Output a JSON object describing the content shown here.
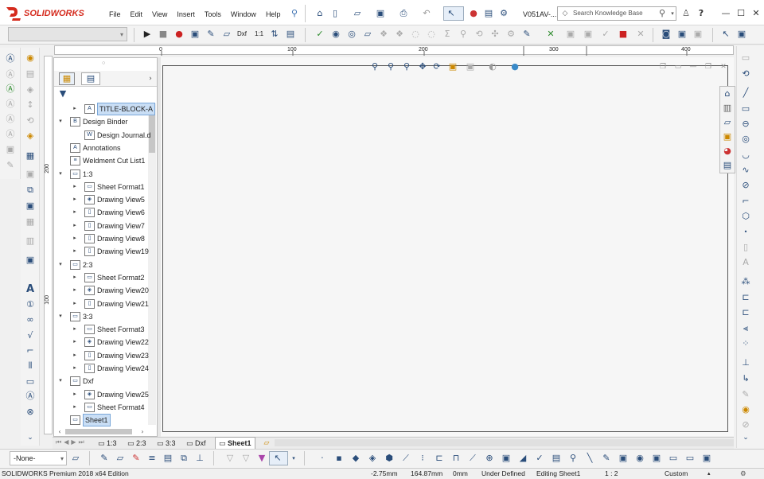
{
  "app": {
    "brand": "SOLIDWORKS",
    "title_short": "V051AV-...",
    "menu": [
      "File",
      "Edit",
      "View",
      "Insert",
      "Tools",
      "Window",
      "Help"
    ],
    "search_placeholder": "Search Knowledge Base"
  },
  "toolbar2": {
    "dxf_label": "Dxf",
    "scale_label": "1:1"
  },
  "ruler": {
    "ticks": [
      "0",
      "100",
      "200",
      "300",
      "400"
    ],
    "vticks": [
      "200",
      "100"
    ]
  },
  "tree": {
    "items": [
      {
        "label": "TITLE-BLOCK-A",
        "level": 1,
        "caret": "▸",
        "icon": "A",
        "selected": true
      },
      {
        "label": "Design Binder",
        "level": 0,
        "caret": "▾",
        "icon": "B"
      },
      {
        "label": "Design Journal.d",
        "level": 1,
        "caret": "",
        "icon": "W"
      },
      {
        "label": "Annotations",
        "level": 0,
        "caret": "",
        "icon": "A"
      },
      {
        "label": "Weldment Cut List1",
        "level": 0,
        "caret": "",
        "icon": "≡"
      },
      {
        "label": "1:3",
        "level": 0,
        "caret": "▾",
        "icon": "▭"
      },
      {
        "label": "Sheet Format1",
        "level": 1,
        "caret": "▸",
        "icon": "▭"
      },
      {
        "label": "Drawing View5",
        "level": 1,
        "caret": "▸",
        "icon": "◈"
      },
      {
        "label": "Drawing View6",
        "level": 1,
        "caret": "▸",
        "icon": "▯"
      },
      {
        "label": "Drawing View7",
        "level": 1,
        "caret": "▸",
        "icon": "▯"
      },
      {
        "label": "Drawing View8",
        "level": 1,
        "caret": "▸",
        "icon": "▯"
      },
      {
        "label": "Drawing View19",
        "level": 1,
        "caret": "▸",
        "icon": "▯"
      },
      {
        "label": "2:3",
        "level": 0,
        "caret": "▾",
        "icon": "▭"
      },
      {
        "label": "Sheet Format2",
        "level": 1,
        "caret": "▸",
        "icon": "▭"
      },
      {
        "label": "Drawing View20",
        "level": 1,
        "caret": "▸",
        "icon": "◈"
      },
      {
        "label": "Drawing View21",
        "level": 1,
        "caret": "▸",
        "icon": "▯"
      },
      {
        "label": "3:3",
        "level": 0,
        "caret": "▾",
        "icon": "▭"
      },
      {
        "label": "Sheet Format3",
        "level": 1,
        "caret": "▸",
        "icon": "▭"
      },
      {
        "label": "Drawing View22",
        "level": 1,
        "caret": "▸",
        "icon": "◈"
      },
      {
        "label": "Drawing View23",
        "level": 1,
        "caret": "▸",
        "icon": "▯"
      },
      {
        "label": "Drawing View24",
        "level": 1,
        "caret": "▸",
        "icon": "▯"
      },
      {
        "label": "Dxf",
        "level": 0,
        "caret": "▾",
        "icon": "▭"
      },
      {
        "label": "Drawing View25",
        "level": 1,
        "caret": "▸",
        "icon": "◈"
      },
      {
        "label": "Sheet Format4",
        "level": 1,
        "caret": "▸",
        "icon": "▭"
      },
      {
        "label": "Sheet1",
        "level": 0,
        "caret": "",
        "icon": "▭",
        "highlight": true
      }
    ]
  },
  "sheet_tabs": [
    "1:3",
    "2:3",
    "3:3",
    "Dxf",
    "Sheet1"
  ],
  "bottom": {
    "layer_select": "-None-"
  },
  "status": {
    "edition": "SOLIDWORKS Premium 2018 x64 Edition",
    "x": "-2.75mm",
    "y": "164.87mm",
    "z": "0mm",
    "defined": "Under Defined",
    "editing": "Editing Sheet1",
    "scale": "1 : 2",
    "units": "Custom"
  },
  "colors": {
    "brand_red": "#d52b1e",
    "accent_blue": "#2a4d7a",
    "selection": "#c9def5"
  }
}
